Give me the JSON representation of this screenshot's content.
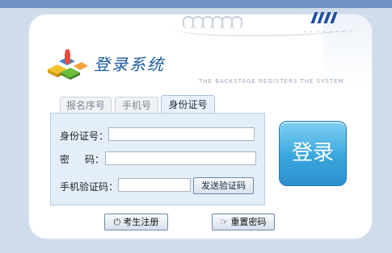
{
  "header": {
    "title": "登录系统",
    "subtitle": "THE BACKSTAGE REGISTERS THE SYSTEM",
    "dots": "- - - - - - - -"
  },
  "tabs": [
    {
      "label": "报名序号",
      "active": false
    },
    {
      "label": "手机号",
      "active": false
    },
    {
      "label": "身份证号",
      "active": true
    }
  ],
  "form": {
    "id_label": "身份证号：",
    "id_value": "",
    "password_label_a": "密",
    "password_label_b": "码：",
    "password_value": "",
    "sms_label": "手机验证码：",
    "sms_value": "",
    "send_code_label": "发送验证码"
  },
  "login_label": "登录",
  "footer": {
    "register_label": "考生注册",
    "reset_label": "重置密码",
    "register_icon": "power-icon",
    "reset_icon": "edit-icon"
  },
  "colors": {
    "accent": "#1b5a9e",
    "login_button": "#39a6dd",
    "background": "#cfdceb"
  }
}
